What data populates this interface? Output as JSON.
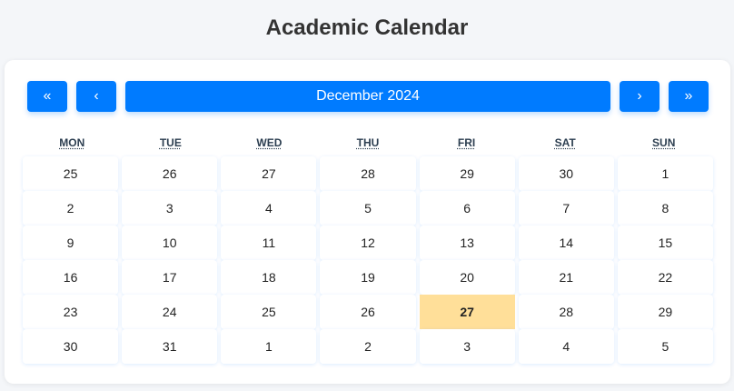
{
  "title": "Academic Calendar",
  "nav": {
    "prev_year": "«",
    "prev_month": "‹",
    "month_label": "December 2024",
    "next_month": "›",
    "next_year": "»"
  },
  "weekdays": [
    "MON",
    "TUE",
    "WED",
    "THU",
    "FRI",
    "SAT",
    "SUN"
  ],
  "weekdays_full": [
    "Monday",
    "Tuesday",
    "Wednesday",
    "Thursday",
    "Friday",
    "Saturday",
    "Sunday"
  ],
  "weeks": [
    [
      "25",
      "26",
      "27",
      "28",
      "29",
      "30",
      "1"
    ],
    [
      "2",
      "3",
      "4",
      "5",
      "6",
      "7",
      "8"
    ],
    [
      "9",
      "10",
      "11",
      "12",
      "13",
      "14",
      "15"
    ],
    [
      "16",
      "17",
      "18",
      "19",
      "20",
      "21",
      "22"
    ],
    [
      "23",
      "24",
      "25",
      "26",
      "27",
      "28",
      "29"
    ],
    [
      "30",
      "31",
      "1",
      "2",
      "3",
      "4",
      "5"
    ]
  ],
  "colors": {
    "accent": "#007bff",
    "today_bg": "#ffdf99",
    "header_text": "#2c3e50"
  }
}
